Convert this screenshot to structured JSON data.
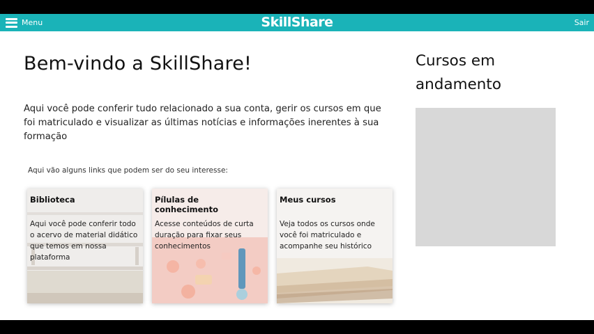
{
  "navbar": {
    "menu_label": "Menu",
    "brand": "SkillShare",
    "logout_label": "Sair",
    "background": "#1ab3b8"
  },
  "main": {
    "title": "Bem-vindo a SkillShare!",
    "intro": "Aqui você pode conferir tudo relacionado a sua conta, gerir os cursos em que foi matriculado e visualizar as últimas notícias e informações inerentes à sua formação",
    "links_note": "Aqui vão alguns links que podem ser do seu interesse:",
    "cards": [
      {
        "title": "Biblioteca",
        "description": "Aqui você pode conferir todo o acervo de material didático que temos em nossa plataforma",
        "icon": "library-shelf-image"
      },
      {
        "title": "Pílulas de conhecimento",
        "description": "Acesse conteúdos de curta duração para fixar seus conhecimentos",
        "icon": "knowledge-pills-image"
      },
      {
        "title": "Meus cursos",
        "description": "Veja todos os cursos onde você foi matriculado e acompanhe seu histórico",
        "icon": "books-image"
      }
    ]
  },
  "sidebar": {
    "title": "Cursos em andamento"
  }
}
